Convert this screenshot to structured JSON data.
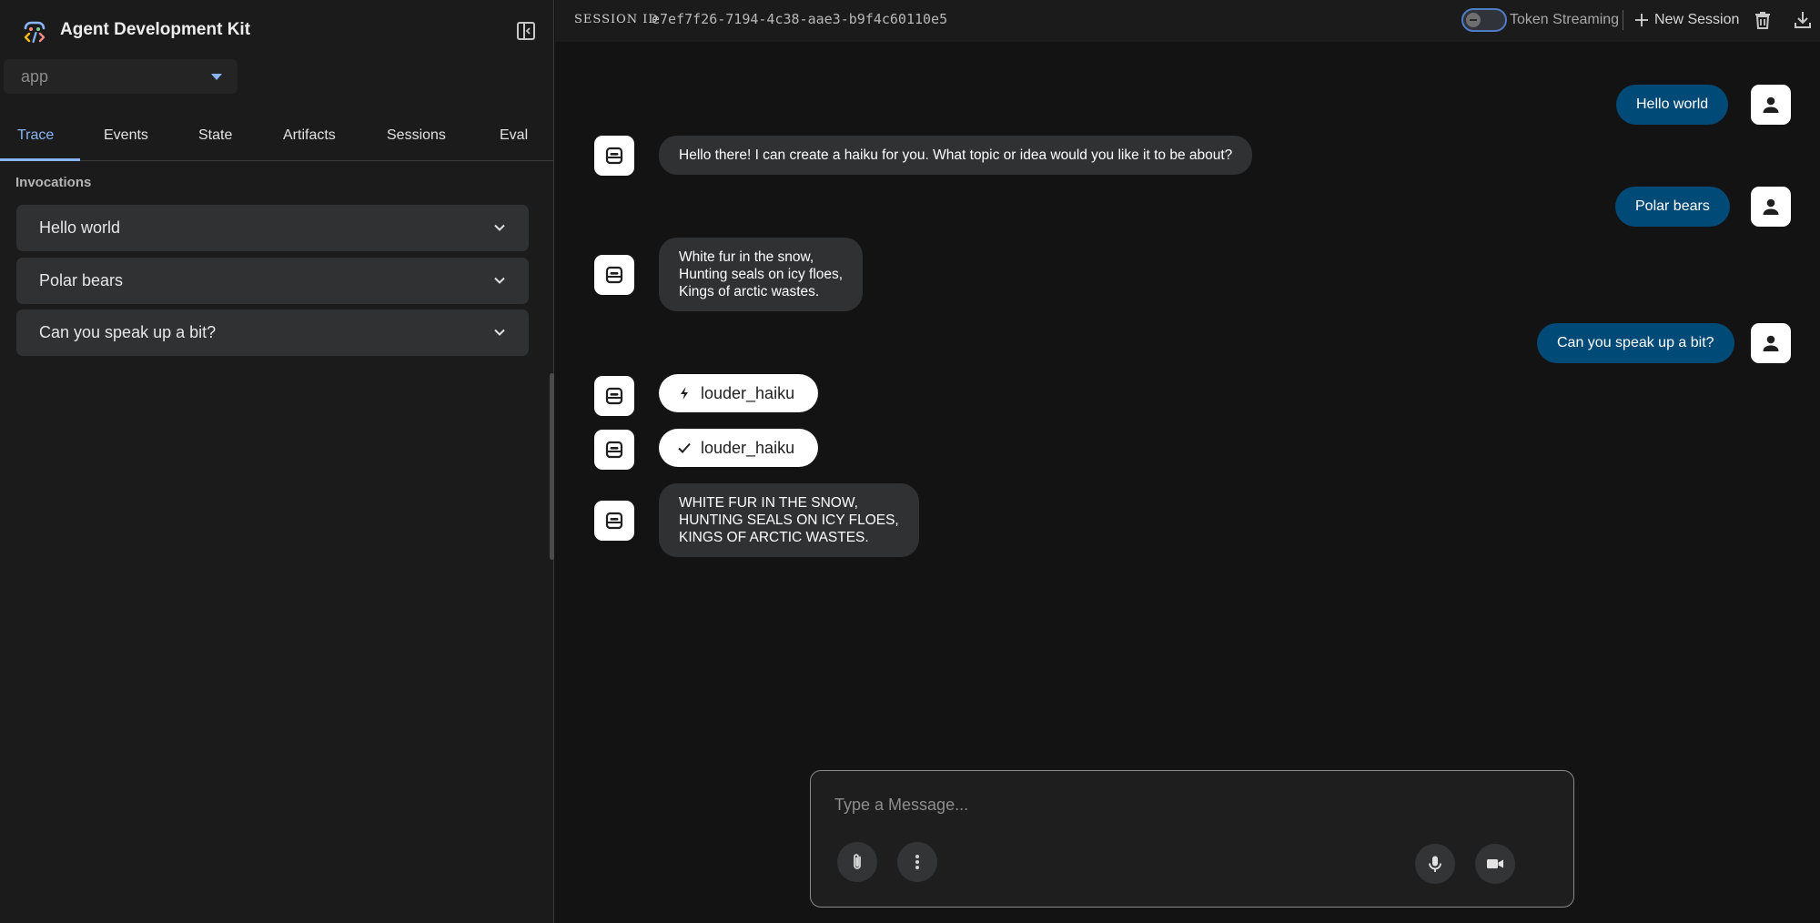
{
  "app": {
    "title": "Agent Development Kit",
    "selected_app": "app"
  },
  "tabs": [
    {
      "label": "Trace"
    },
    {
      "label": "Events"
    },
    {
      "label": "State"
    },
    {
      "label": "Artifacts"
    },
    {
      "label": "Sessions"
    },
    {
      "label": "Eval"
    }
  ],
  "invocations": {
    "label": "Invocations",
    "items": [
      {
        "label": "Hello world"
      },
      {
        "label": "Polar bears"
      },
      {
        "label": "Can you speak up a bit?"
      }
    ]
  },
  "header": {
    "session_label": "SESSION ID",
    "session_id": "e7ef7f26-7194-4c38-aae3-b9f4c60110e5",
    "token_streaming_label": "Token Streaming",
    "new_session_label": "New Session"
  },
  "messages": [
    {
      "role": "user",
      "text": "Hello world"
    },
    {
      "role": "bot",
      "lines": [
        "Hello there! I can create a haiku for you. What topic or idea would you like it to be about?"
      ]
    },
    {
      "role": "user",
      "text": "Polar bears"
    },
    {
      "role": "bot",
      "lines": [
        "White fur in the snow,",
        "Hunting seals on icy floes,",
        "Kings of arctic wastes."
      ]
    },
    {
      "role": "user",
      "text": "Can you speak up a bit?"
    },
    {
      "role": "function_call",
      "icon": "bolt-icon",
      "text": "louder_haiku"
    },
    {
      "role": "function_response",
      "icon": "check-icon",
      "text": "louder_haiku"
    },
    {
      "role": "bot",
      "lines": [
        "WHITE FUR IN THE SNOW,",
        "HUNTING SEALS ON ICY FLOES,",
        "KINGS OF ARCTIC WASTES."
      ]
    }
  ],
  "composer": {
    "placeholder": "Type a Message..."
  },
  "colors": {
    "accent": "#8ab4f8",
    "user_bubble": "#004a77",
    "bot_bubble": "#303132",
    "background": "#131314"
  }
}
